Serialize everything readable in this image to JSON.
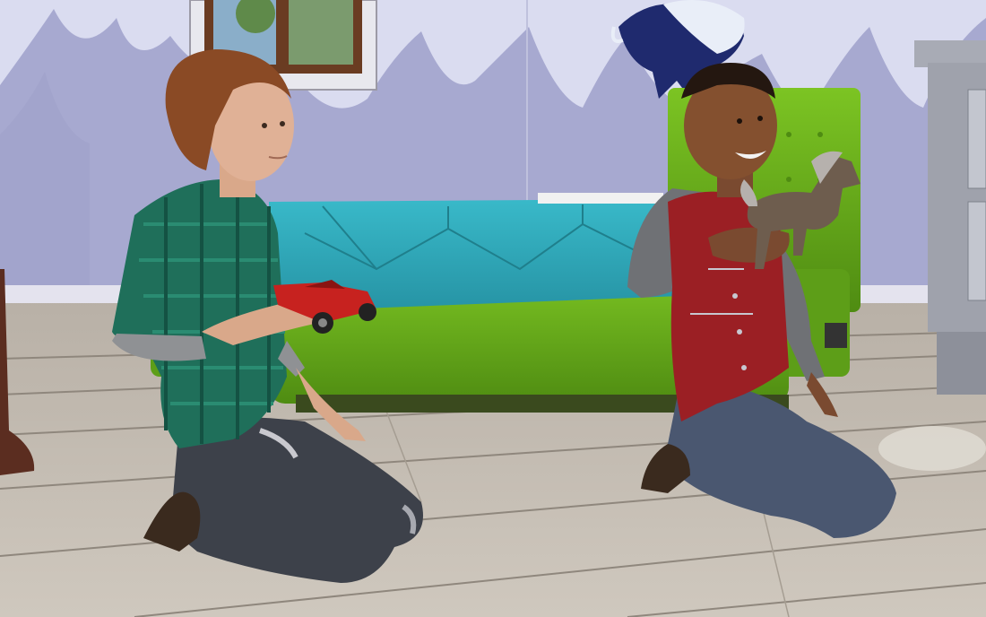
{
  "scene": {
    "palette": {
      "wall": "#a6a8cf",
      "wall_grass": "#d9dcef",
      "floor": "#c7bfb4",
      "floor_line": "#8f877d",
      "sofa_green": "#6fb51f",
      "sofa_teal": "#2fa7b8",
      "plaid_green": "#1f6f5a",
      "vest_red": "#9b1f24",
      "jeans": "#3d414a"
    },
    "icons": [
      "window-icon",
      "unicorn-wall-decal-icon",
      "toy-car-icon",
      "toy-horse-icon"
    ]
  }
}
